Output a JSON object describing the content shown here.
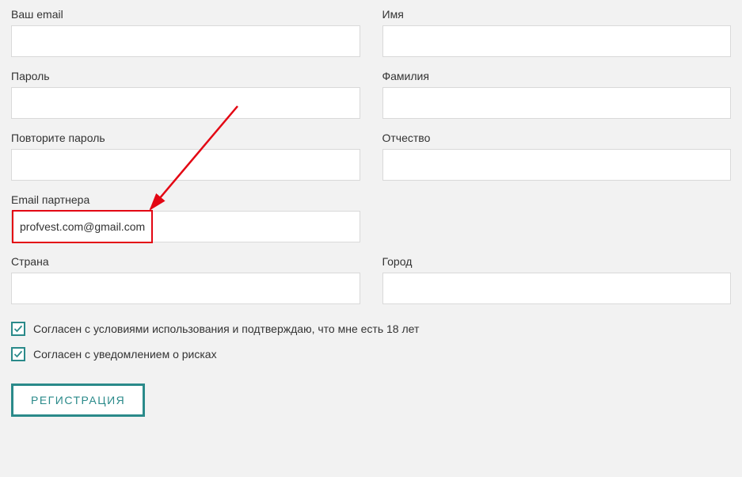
{
  "fields": {
    "email": {
      "label": "Ваш email",
      "value": ""
    },
    "name": {
      "label": "Имя",
      "value": ""
    },
    "password": {
      "label": "Пароль",
      "value": ""
    },
    "surname": {
      "label": "Фамилия",
      "value": ""
    },
    "password2": {
      "label": "Повторите пароль",
      "value": ""
    },
    "patronymic": {
      "label": "Отчество",
      "value": ""
    },
    "partner_email": {
      "label": "Email партнера",
      "value": "profvest.com@gmail.com"
    },
    "country": {
      "label": "Страна",
      "value": ""
    },
    "city": {
      "label": "Город",
      "value": ""
    }
  },
  "checks": {
    "terms": {
      "checked": true,
      "label": "Согласен с условиями использования и подтверждаю, что мне есть 18 лет"
    },
    "risks": {
      "checked": true,
      "label": "Согласен с уведомлением о рисках"
    }
  },
  "submit": {
    "label": "РЕГИСТРАЦИЯ"
  },
  "annotation": {
    "highlight_color": "#e30613",
    "teal": "#2a8a8a"
  }
}
